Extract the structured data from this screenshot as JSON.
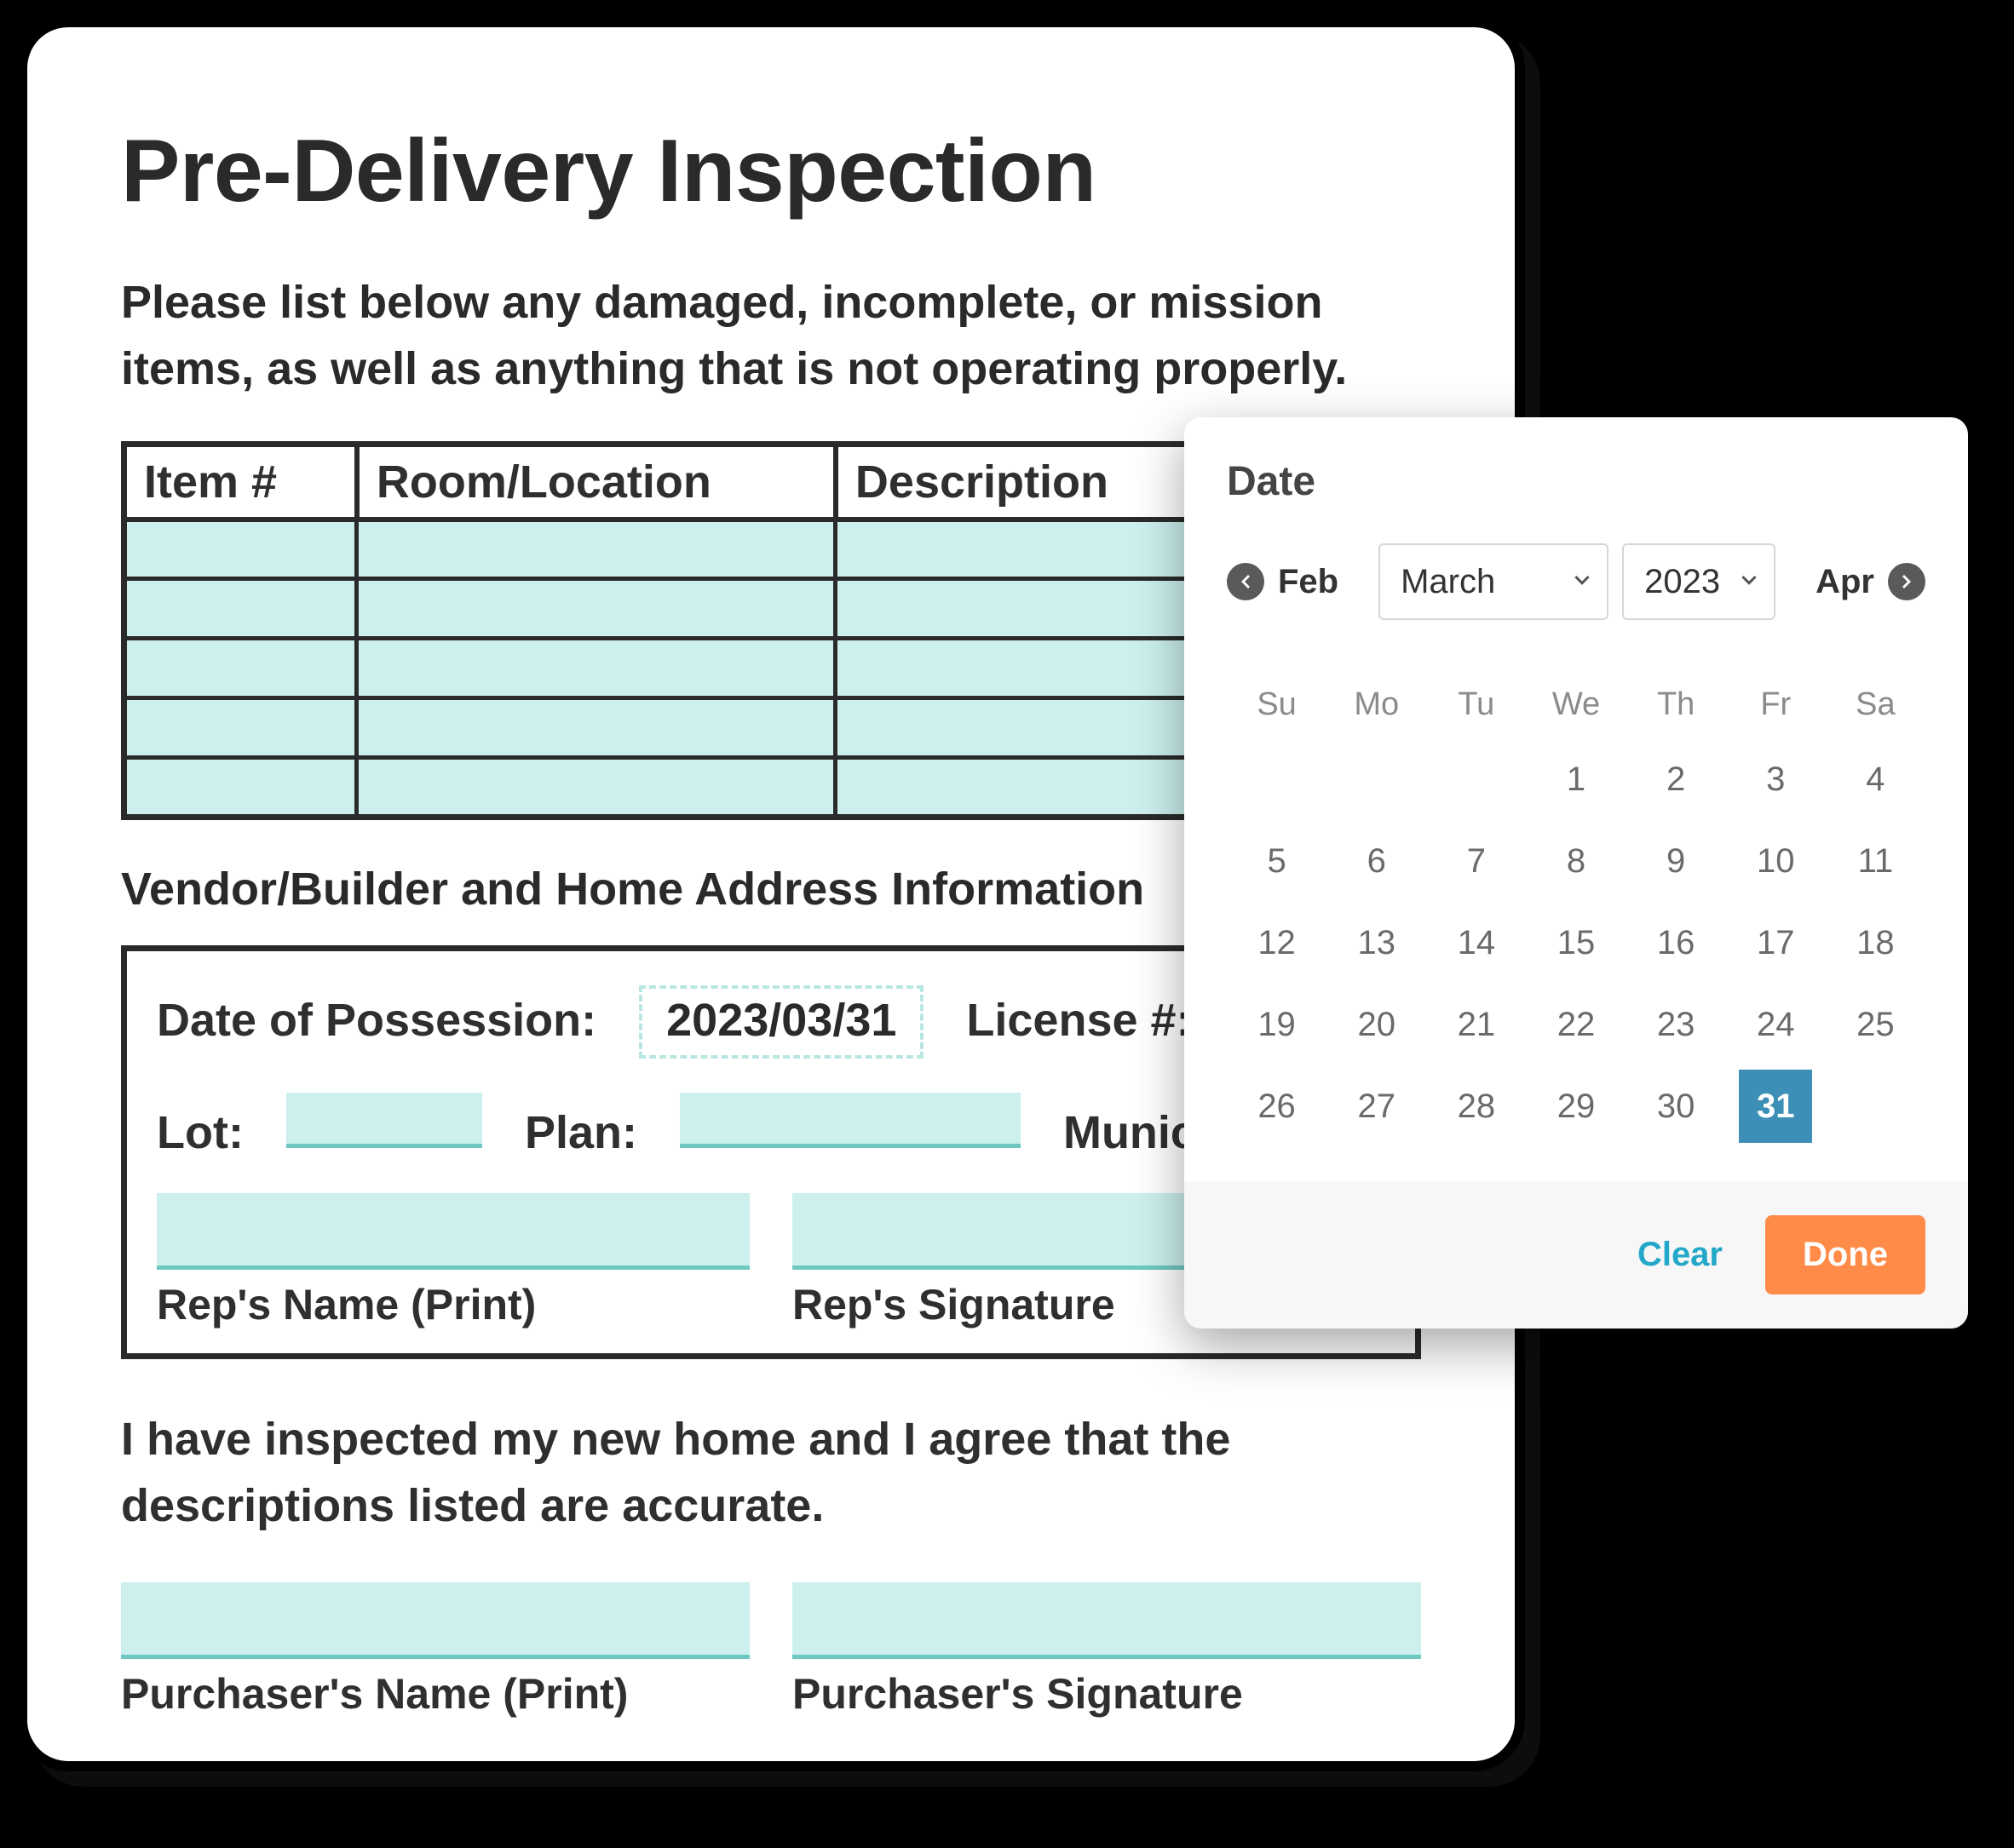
{
  "form": {
    "title": "Pre-Delivery Inspection",
    "intro": "Please list below any damaged, incomplete, or mission items, as well as anything that is not operating properly.",
    "table_headers": {
      "c1": "Item #",
      "c2": "Room/Location",
      "c3": "Description"
    },
    "vendor_heading": "Vendor/Builder and Home Address Information",
    "fields": {
      "date_of_possession_label": "Date of Possession:",
      "date_of_possession_value": "2023/03/31",
      "license_label": "License #:",
      "lot_label": "Lot:",
      "plan_label": "Plan:",
      "municipality_label": "Municipality:",
      "rep_name_caption": "Rep's Name (Print)",
      "rep_sig_caption": "Rep's Signature"
    },
    "attestation": "I have inspected my new home and I agree that the descriptions listed are accurate.",
    "purchaser": {
      "name_caption": "Purchaser's Name (Print)",
      "sig_caption": "Purchaser's Signature"
    }
  },
  "datepicker": {
    "title": "Date",
    "prev_month": "Feb",
    "next_month": "Apr",
    "month_select": "March",
    "year_select": "2023",
    "dow": [
      "Su",
      "Mo",
      "Tu",
      "We",
      "Th",
      "Fr",
      "Sa"
    ],
    "weeks": [
      [
        "",
        "",
        "",
        "1",
        "2",
        "3",
        "4"
      ],
      [
        "5",
        "6",
        "7",
        "8",
        "9",
        "10",
        "11"
      ],
      [
        "12",
        "13",
        "14",
        "15",
        "16",
        "17",
        "18"
      ],
      [
        "19",
        "20",
        "21",
        "22",
        "23",
        "24",
        "25"
      ],
      [
        "26",
        "27",
        "28",
        "29",
        "30",
        "31",
        ""
      ]
    ],
    "selected_day": "31",
    "clear_label": "Clear",
    "done_label": "Done"
  }
}
